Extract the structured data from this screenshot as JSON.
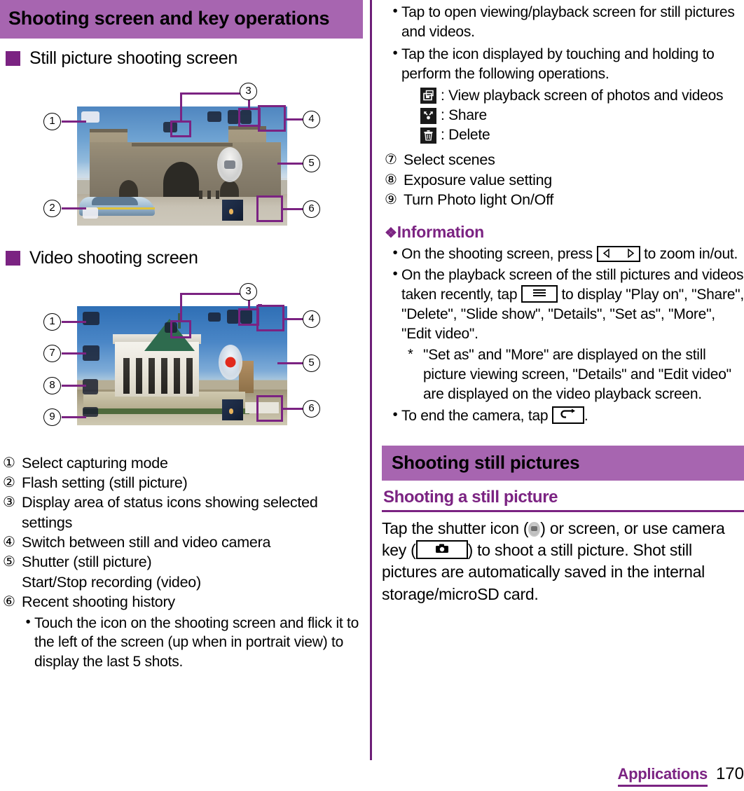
{
  "left_column": {
    "chapter_title": "Shooting screen and key operations",
    "section_still": "Still picture shooting screen",
    "section_video": "Video shooting screen",
    "still_diagram": {
      "callouts": [
        "1",
        "2",
        "3",
        "4",
        "5",
        "6"
      ]
    },
    "video_diagram": {
      "callouts": [
        "1",
        "3",
        "4",
        "5",
        "6",
        "7",
        "8",
        "9"
      ]
    },
    "legend": [
      {
        "num": "1",
        "text": "Select capturing mode"
      },
      {
        "num": "2",
        "text": "Flash setting (still picture)"
      },
      {
        "num": "3",
        "text": "Display area of status icons showing selected settings"
      },
      {
        "num": "4",
        "text": "Switch between still and video camera"
      },
      {
        "num": "5",
        "text": "Shutter (still picture)",
        "continuation": "Start/Stop recording (video)"
      },
      {
        "num": "6",
        "text": "Recent shooting history"
      }
    ],
    "legend_6_bullets": [
      "Touch the icon on the shooting screen and flick it to the left of the screen (up when in portrait view) to display the last 5 shots."
    ]
  },
  "right_column": {
    "top_bullets": [
      "Tap to open viewing/playback screen for still pictures and videos.",
      "Tap the icon displayed by touching and holding to perform the following operations."
    ],
    "icon_actions": [
      {
        "icon": "playback-screen-icon",
        "label": ": View playback screen of photos and videos"
      },
      {
        "icon": "share-icon",
        "label": ": Share"
      },
      {
        "icon": "delete-trash-icon",
        "label": ": Delete"
      }
    ],
    "legend": [
      {
        "num": "7",
        "text": "Select scenes"
      },
      {
        "num": "8",
        "text": "Exposure value setting"
      },
      {
        "num": "9",
        "text": "Turn Photo light On/Off"
      }
    ],
    "information": {
      "heading": "Information",
      "flower": "❖",
      "bullets": [
        {
          "parts": [
            {
              "type": "text",
              "value": "On the shooting screen, press "
            },
            {
              "type": "key",
              "value": "volume-key-icon"
            },
            {
              "type": "text",
              "value": " to zoom in/out."
            }
          ]
        },
        {
          "parts": [
            {
              "type": "text",
              "value": "On the playback screen of the still pictures and videos taken recently, tap "
            },
            {
              "type": "key",
              "value": "menu-key-icon"
            },
            {
              "type": "text",
              "value": " to display \"Play on\", \"Share\", \"Delete\", \"Slide show\", \"Details\", \"Set as\", \"More\", \"Edit video\"."
            }
          ]
        }
      ],
      "note_star": "*",
      "note": "\"Set as\" and \"More\" are displayed on the still picture viewing screen, \"Details\" and \"Edit video\" are displayed on the video playback screen.",
      "last_bullet": {
        "parts": [
          {
            "type": "text",
            "value": "To end the camera, tap "
          },
          {
            "type": "key",
            "value": "back-key-icon"
          },
          {
            "type": "text",
            "value": "."
          }
        ]
      }
    },
    "section_bar": "Shooting still pictures",
    "sub_heading": "Shooting a still picture",
    "paragraph": {
      "parts": [
        {
          "type": "text",
          "value": "Tap the shutter icon ("
        },
        {
          "type": "icon",
          "value": "shutter-icon"
        },
        {
          "type": "text",
          "value": ") or screen, or use camera key ("
        },
        {
          "type": "key",
          "value": "camera-key-icon"
        },
        {
          "type": "text",
          "value": ") to shoot a still picture. Shot still pictures are automatically saved in the internal storage/microSD card."
        }
      ]
    }
  },
  "footer": {
    "label": "Applications",
    "page": "170"
  },
  "colors": {
    "header_bar": "#a765b0",
    "accent_dark": "#7b2382",
    "text": "#000000"
  }
}
